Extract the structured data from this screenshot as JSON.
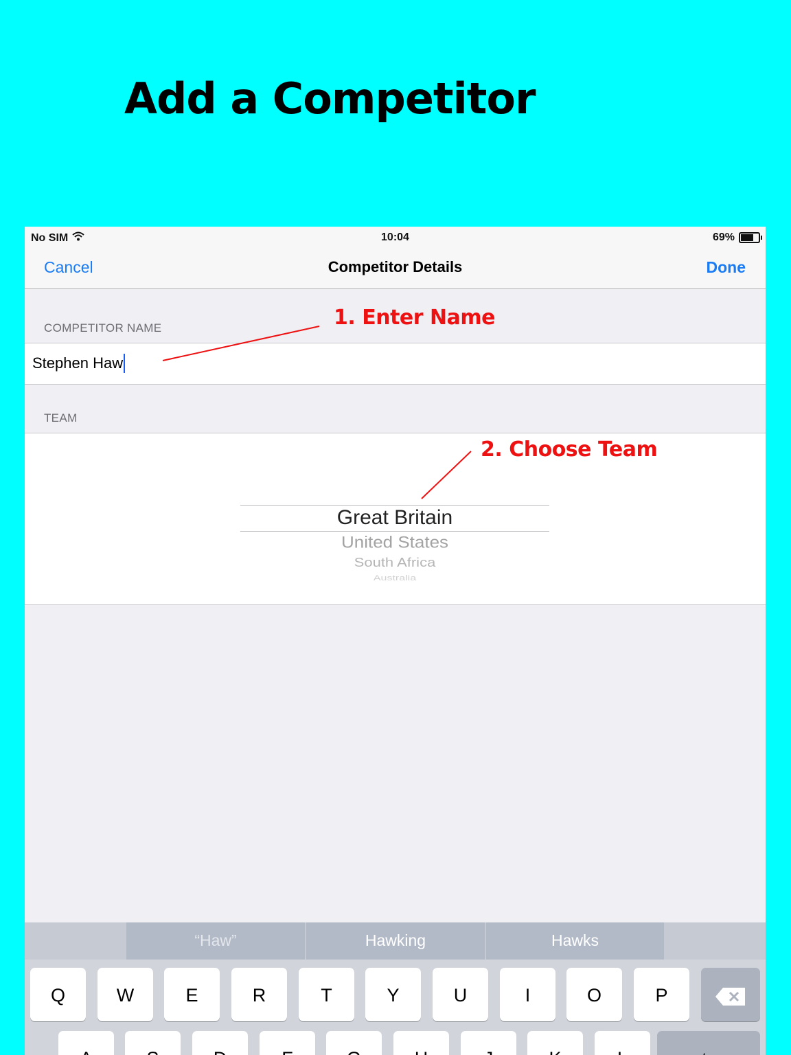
{
  "headline": "Add a Competitor",
  "status_bar": {
    "carrier": "No SIM",
    "time": "10:04",
    "battery": "69%",
    "battery_level": 0.69
  },
  "nav": {
    "cancel": "Cancel",
    "title": "Competitor Details",
    "done": "Done"
  },
  "form": {
    "name_header": "COMPETITOR NAME",
    "name_value": "Stephen Haw",
    "team_header": "TEAM",
    "team_options": [
      "Great Britain",
      "United States",
      "South Africa",
      "Australia"
    ],
    "team_selected": "Great Britain"
  },
  "annotations": {
    "step1": "1. Enter Name",
    "step2": "2. Choose Team"
  },
  "colors": {
    "background": "#00ffff",
    "accent": "#1a7cf4",
    "annotation": "#ee1111"
  },
  "keyboard": {
    "suggestions": [
      "“Haw”",
      "Hawking",
      "Hawks"
    ],
    "row1": [
      "Q",
      "W",
      "E",
      "R",
      "T",
      "Y",
      "U",
      "I",
      "O",
      "P"
    ],
    "row2": [
      "A",
      "S",
      "D",
      "F",
      "G",
      "H",
      "J",
      "K",
      "L"
    ],
    "return_label": "return",
    "backspace_icon": "backspace-icon"
  }
}
